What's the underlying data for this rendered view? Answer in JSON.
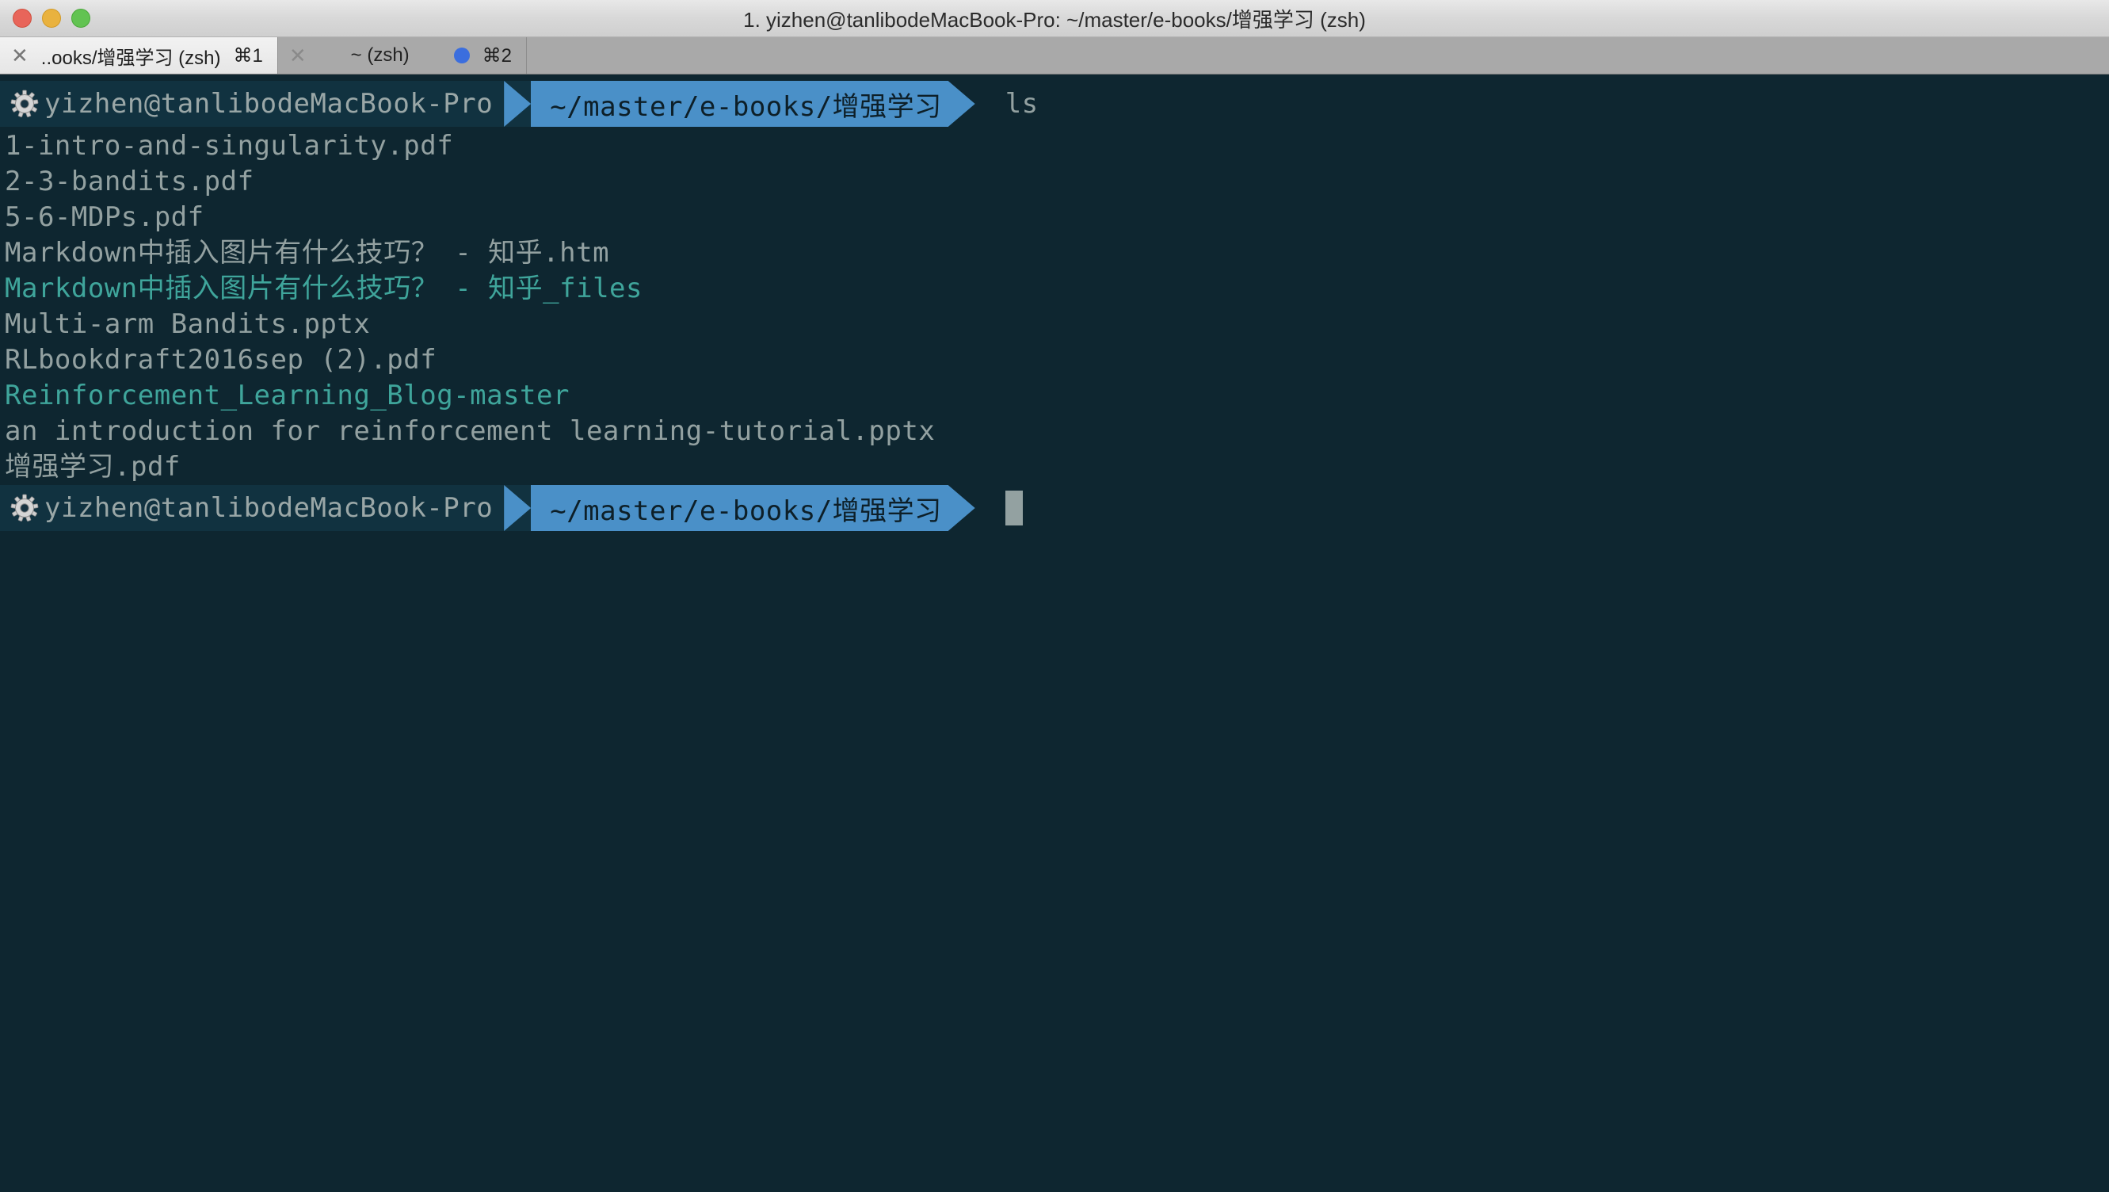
{
  "window": {
    "title": "1. yizhen@tanlibodeMacBook-Pro: ~/master/e-books/增强学习 (zsh)",
    "traffic_lights": {
      "close": "close",
      "minimize": "minimize",
      "maximize": "maximize"
    }
  },
  "tabs": [
    {
      "close_glyph": "✕",
      "title": "..ooks/增强学习 (zsh)",
      "shortcut": "⌘1",
      "active": true,
      "has_dot": false
    },
    {
      "close_glyph": "✕",
      "title": "~ (zsh)",
      "shortcut": "⌘2",
      "active": false,
      "has_dot": true
    }
  ],
  "colors": {
    "terminal_background": "#0e2630",
    "prompt_user_background": "#113240",
    "prompt_path_background": "#4a90c8",
    "prompt_path_text": "#0d1f28",
    "output_text": "#93a1a1",
    "directory_text": "#3fa59b",
    "cursor": "#93a1a1",
    "tab_dot": "#3b6ede",
    "titlebar_text": "#2b2b2b"
  },
  "terminal": {
    "prompt_top": {
      "icon": "gear-icon",
      "user_host": "yizhen@tanlibodeMacBook-Pro",
      "path": "~/master/e-books/增强学习",
      "command": "ls"
    },
    "output_lines": [
      {
        "text": "1-intro-and-singularity.pdf",
        "kind": "file"
      },
      {
        "text": "2-3-bandits.pdf",
        "kind": "file"
      },
      {
        "text": "5-6-MDPs.pdf",
        "kind": "file"
      },
      {
        "text": "Markdown中插入图片有什么技巧？ - 知乎.htm",
        "kind": "file"
      },
      {
        "text": "Markdown中插入图片有什么技巧？ - 知乎_files",
        "kind": "directory"
      },
      {
        "text": "Multi-arm Bandits.pptx",
        "kind": "file"
      },
      {
        "text": "RLbookdraft2016sep (2).pdf",
        "kind": "file"
      },
      {
        "text": "Reinforcement_Learning_Blog-master",
        "kind": "directory"
      },
      {
        "text": "an introduction for reinforcement learning-tutorial.pptx",
        "kind": "file"
      },
      {
        "text": "增强学习.pdf",
        "kind": "file"
      }
    ],
    "prompt_bottom": {
      "icon": "gear-icon",
      "user_host": "yizhen@tanlibodeMacBook-Pro",
      "path": "~/master/e-books/增强学习",
      "command": ""
    }
  }
}
